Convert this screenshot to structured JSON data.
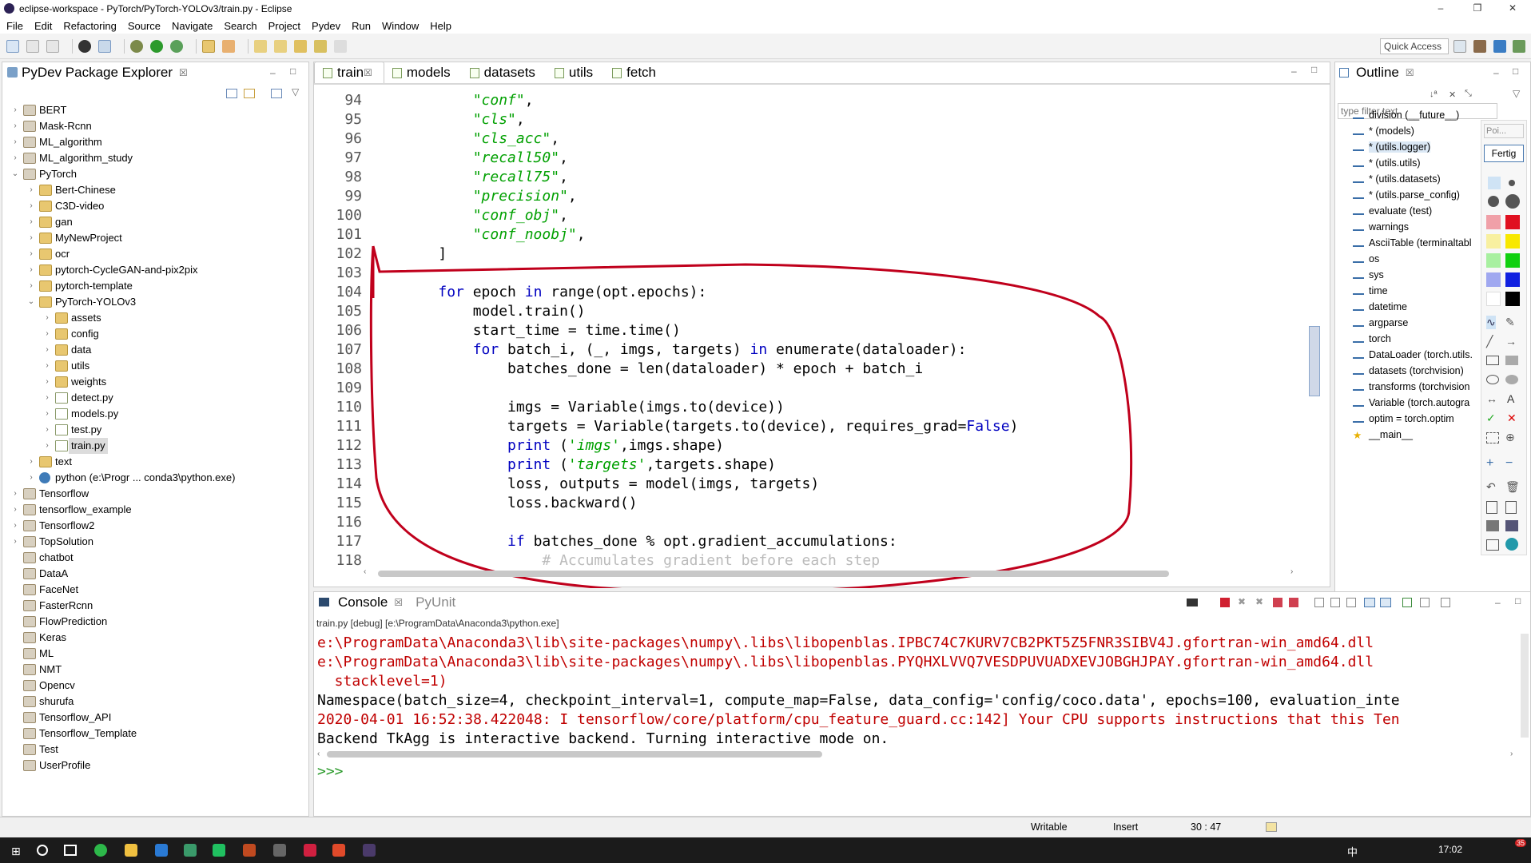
{
  "window": {
    "title": "eclipse-workspace - PyTorch/PyTorch-YOLOv3/train.py - Eclipse",
    "controls": [
      "–",
      "❐",
      "✕"
    ]
  },
  "menu": [
    "File",
    "Edit",
    "Refactoring",
    "Source",
    "Navigate",
    "Search",
    "Project",
    "Pydev",
    "Run",
    "Window",
    "Help"
  ],
  "toolbar": {
    "quick_access": "Quick Access"
  },
  "explorer": {
    "title": "PyDev Package Explorer",
    "items": [
      {
        "label": "BERT",
        "depth": 0,
        "arrow": "›",
        "type": "proj"
      },
      {
        "label": "Mask-Rcnn",
        "depth": 0,
        "arrow": "›",
        "type": "proj"
      },
      {
        "label": "ML_algorithm",
        "depth": 0,
        "arrow": "›",
        "type": "proj"
      },
      {
        "label": "ML_algorithm_study",
        "depth": 0,
        "arrow": "›",
        "type": "proj"
      },
      {
        "label": "PyTorch",
        "depth": 0,
        "arrow": "⌄",
        "type": "proj"
      },
      {
        "label": "Bert-Chinese",
        "depth": 1,
        "arrow": "›",
        "type": "folder"
      },
      {
        "label": "C3D-video",
        "depth": 1,
        "arrow": "›",
        "type": "folder"
      },
      {
        "label": "gan",
        "depth": 1,
        "arrow": "›",
        "type": "folder"
      },
      {
        "label": "MyNewProject",
        "depth": 1,
        "arrow": "›",
        "type": "folder"
      },
      {
        "label": "ocr",
        "depth": 1,
        "arrow": "›",
        "type": "folder"
      },
      {
        "label": "pytorch-CycleGAN-and-pix2pix",
        "depth": 1,
        "arrow": "›",
        "type": "folder"
      },
      {
        "label": "pytorch-template",
        "depth": 1,
        "arrow": "›",
        "type": "folder"
      },
      {
        "label": "PyTorch-YOLOv3",
        "depth": 1,
        "arrow": "⌄",
        "type": "folder"
      },
      {
        "label": "assets",
        "depth": 2,
        "arrow": "›",
        "type": "folder"
      },
      {
        "label": "config",
        "depth": 2,
        "arrow": "›",
        "type": "folder"
      },
      {
        "label": "data",
        "depth": 2,
        "arrow": "›",
        "type": "folder"
      },
      {
        "label": "utils",
        "depth": 2,
        "arrow": "›",
        "type": "folder"
      },
      {
        "label": "weights",
        "depth": 2,
        "arrow": "›",
        "type": "folder"
      },
      {
        "label": "detect.py",
        "depth": 2,
        "arrow": "›",
        "type": "pyfile"
      },
      {
        "label": "models.py",
        "depth": 2,
        "arrow": "›",
        "type": "pyfile"
      },
      {
        "label": "test.py",
        "depth": 2,
        "arrow": "›",
        "type": "pyfile"
      },
      {
        "label": "train.py",
        "depth": 2,
        "arrow": "›",
        "type": "pyfile",
        "selected": true
      },
      {
        "label": "text",
        "depth": 1,
        "arrow": "›",
        "type": "folder"
      },
      {
        "label": "python   (e:\\Progr ... conda3\\python.exe)",
        "depth": 1,
        "arrow": "›",
        "type": "pyenv"
      },
      {
        "label": "Tensorflow",
        "depth": 0,
        "arrow": "›",
        "type": "proj"
      },
      {
        "label": "tensorflow_example",
        "depth": 0,
        "arrow": "›",
        "type": "proj"
      },
      {
        "label": "Tensorflow2",
        "depth": 0,
        "arrow": "›",
        "type": "proj"
      },
      {
        "label": "TopSolution",
        "depth": 0,
        "arrow": "›",
        "type": "proj"
      },
      {
        "label": "chatbot",
        "depth": 0,
        "arrow": "",
        "type": "proj"
      },
      {
        "label": "DataA",
        "depth": 0,
        "arrow": "",
        "type": "proj"
      },
      {
        "label": "FaceNet",
        "depth": 0,
        "arrow": "",
        "type": "proj"
      },
      {
        "label": "FasterRcnn",
        "depth": 0,
        "arrow": "",
        "type": "proj"
      },
      {
        "label": "FlowPrediction",
        "depth": 0,
        "arrow": "",
        "type": "proj"
      },
      {
        "label": "Keras",
        "depth": 0,
        "arrow": "",
        "type": "proj"
      },
      {
        "label": "ML",
        "depth": 0,
        "arrow": "",
        "type": "proj"
      },
      {
        "label": "NMT",
        "depth": 0,
        "arrow": "",
        "type": "proj"
      },
      {
        "label": "Opencv",
        "depth": 0,
        "arrow": "",
        "type": "proj"
      },
      {
        "label": "shurufa",
        "depth": 0,
        "arrow": "",
        "type": "proj"
      },
      {
        "label": "Tensorflow_API",
        "depth": 0,
        "arrow": "",
        "type": "proj"
      },
      {
        "label": "Tensorflow_Template",
        "depth": 0,
        "arrow": "",
        "type": "proj"
      },
      {
        "label": "Test",
        "depth": 0,
        "arrow": "",
        "type": "proj"
      },
      {
        "label": "UserProfile",
        "depth": 0,
        "arrow": "",
        "type": "proj"
      }
    ]
  },
  "editor": {
    "tabs": [
      "train",
      "models",
      "datasets",
      "utils",
      "fetch"
    ],
    "active_tab": "train",
    "lines": [
      {
        "n": "94",
        "html": "        <span class=\"str\">\"conf\"</span>,"
      },
      {
        "n": "95",
        "html": "        <span class=\"str\">\"cls\"</span>,"
      },
      {
        "n": "96",
        "html": "        <span class=\"str\">\"cls_acc\"</span>,"
      },
      {
        "n": "97",
        "html": "        <span class=\"str\">\"recall50\"</span>,"
      },
      {
        "n": "98",
        "html": "        <span class=\"str\">\"recall75\"</span>,"
      },
      {
        "n": "99",
        "html": "        <span class=\"str\">\"precision\"</span>,"
      },
      {
        "n": "100",
        "html": "        <span class=\"str\">\"conf_obj\"</span>,"
      },
      {
        "n": "101",
        "html": "        <span class=\"str\">\"conf_noobj\"</span>,"
      },
      {
        "n": "102",
        "html": "    ]"
      },
      {
        "n": "103",
        "html": ""
      },
      {
        "n": "104",
        "html": "    <span class=\"kw\">for</span> epoch <span class=\"kw\">in</span> range(opt.epochs):"
      },
      {
        "n": "105",
        "html": "        model.train()"
      },
      {
        "n": "106",
        "html": "        start_time = time.time()"
      },
      {
        "n": "107",
        "html": "        <span class=\"kw\">for</span> batch_i, (_, imgs, targets) <span class=\"kw\">in</span> enumerate(dataloader):"
      },
      {
        "n": "108",
        "html": "            batches_done = len(dataloader) * epoch + batch_i"
      },
      {
        "n": "109",
        "html": ""
      },
      {
        "n": "110",
        "html": "            imgs = Variable(imgs.to(device))"
      },
      {
        "n": "111",
        "html": "            targets = Variable(targets.to(device), requires_grad=<span class=\"kw\">False</span>)"
      },
      {
        "n": "112",
        "html": "            <span class=\"kw\">print</span> (<span class=\"str\">'imgs'</span>,imgs.shape)"
      },
      {
        "n": "113",
        "html": "            <span class=\"kw\">print</span> (<span class=\"str\">'targets'</span>,targets.shape)"
      },
      {
        "n": "114",
        "html": "            loss, outputs = model(imgs, targets)"
      },
      {
        "n": "115",
        "html": "            loss.backward()"
      },
      {
        "n": "116",
        "html": ""
      },
      {
        "n": "117",
        "html": "            <span class=\"kw\">if</span> batches_done % opt.gradient_accumulations:"
      },
      {
        "n": "118",
        "html": "                <span class=\"cmt\"># Accumulates gradient before each step</span>"
      }
    ]
  },
  "outline": {
    "title": "Outline",
    "filter_placeholder": "type filter text",
    "items": [
      "division (__future__)",
      "* (models)",
      "* (utils.logger)",
      "* (utils.utils)",
      "* (utils.datasets)",
      "* (utils.parse_config)",
      "evaluate (test)",
      "warnings",
      "AsciiTable (terminaltabl",
      "os",
      "sys",
      "time",
      "datetime",
      "argparse",
      "torch",
      "DataLoader (torch.utils.",
      "datasets (torchvision)",
      "transforms (torchvision",
      "Variable (torch.autogra",
      "optim = torch.optim",
      "__main__"
    ],
    "palette_buttons": [
      "Poi...",
      "Fertig"
    ]
  },
  "console": {
    "tabs": [
      "Console",
      "PyUnit"
    ],
    "process": "train.py [debug] [e:\\ProgramData\\Anaconda3\\python.exe]",
    "lines": [
      {
        "cls": "red",
        "text": "e:\\ProgramData\\Anaconda3\\lib\\site-packages\\numpy\\.libs\\libopenblas.IPBC74C7KURV7CB2PKT5Z5FNR3SIBV4J.gfortran-win_amd64.dll"
      },
      {
        "cls": "red",
        "text": "e:\\ProgramData\\Anaconda3\\lib\\site-packages\\numpy\\.libs\\libopenblas.PYQHXLVVQ7VESDPUVUADXEVJOBGHJPAY.gfortran-win_amd64.dll"
      },
      {
        "cls": "red",
        "text": "  stacklevel=1)"
      },
      {
        "cls": "",
        "text": "Namespace(batch_size=4, checkpoint_interval=1, compute_map=False, data_config='config/coco.data', epochs=100, evaluation_inte"
      },
      {
        "cls": "red",
        "text": "2020-04-01 16:52:38.422048: I tensorflow/core/platform/cpu_feature_guard.cc:142] Your CPU supports instructions that this Ten"
      },
      {
        "cls": "",
        "text": "Backend TkAgg is interactive backend. Turning interactive mode on."
      }
    ],
    "prompt": ">>>"
  },
  "status": {
    "writable": "Writable",
    "insert": "Insert",
    "position": "30 : 47"
  },
  "taskbar": {
    "time": "17:02",
    "ime": "中",
    "badge": "35"
  }
}
